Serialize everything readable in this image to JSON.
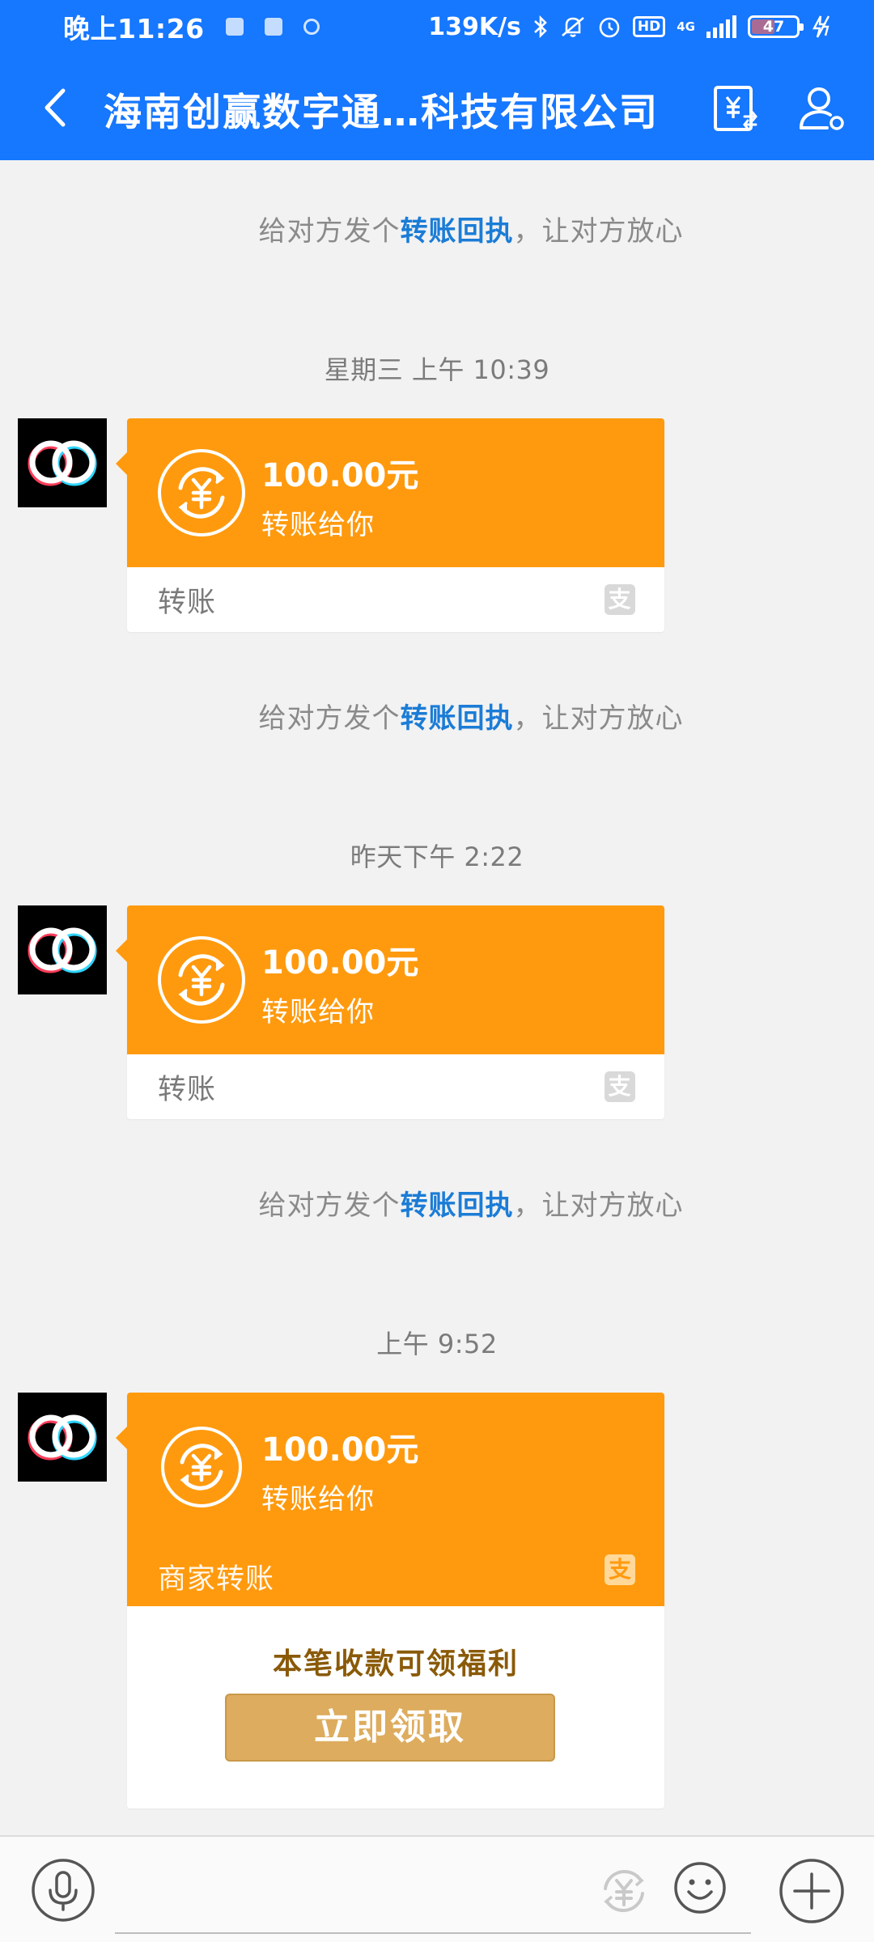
{
  "status_bar": {
    "time": "晚上11:26",
    "network_speed": "139K/s",
    "network_type": "4G",
    "battery": "47",
    "icons": [
      "bluetooth-icon",
      "mute-icon",
      "alarm-icon",
      "hd-icon",
      "signal-icon",
      "battery-icon",
      "charging-icon"
    ]
  },
  "header": {
    "title": "海南创赢数字通…科技有限公司",
    "back_icon": "back-icon",
    "bill_icon": "bill-icon",
    "profile_icon": "profile-icon"
  },
  "messages": [
    {
      "system_prefix": "给对方发个",
      "system_link": "转账回执",
      "system_suffix": "，让对方放心"
    },
    {
      "timestamp": "星期三 上午 10:39",
      "amount": "100.00元",
      "desc": "转账给你",
      "type_label": "转账",
      "system_prefix": "给对方发个",
      "system_link": "转账回执",
      "system_suffix": "，让对方放心"
    },
    {
      "timestamp": "昨天下午 2:22",
      "amount": "100.00元",
      "desc": "转账给你",
      "type_label": "转账",
      "system_prefix": "给对方发个",
      "system_link": "转账回执",
      "system_suffix": "，让对方放心"
    },
    {
      "timestamp": "上午 9:52",
      "amount": "100.00元",
      "desc": "转账给你",
      "type_label": "商家转账",
      "benefit_text": "本笔收款可领福利",
      "claim_label": "立即领取"
    }
  ],
  "alipay_glyph": "支",
  "colors": {
    "brand_blue": "#1677ff",
    "transfer_orange": "#ff9a0e",
    "link_blue": "#1b7cd6",
    "claim_gold": "#ddac5e",
    "benefit_brown": "#8a5a08"
  },
  "input_bar": {
    "voice_icon": "microphone-icon",
    "transfer_icon": "yuan-transfer-icon",
    "emoji_icon": "emoji-icon",
    "plus_icon": "plus-icon",
    "text_value": ""
  }
}
